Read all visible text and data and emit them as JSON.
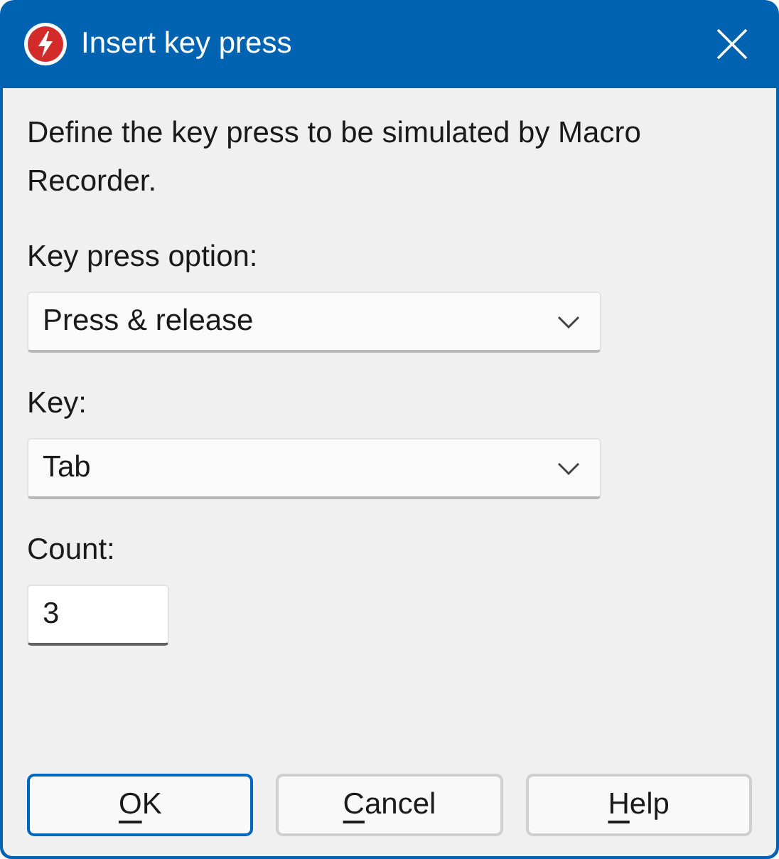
{
  "window": {
    "title": "Insert key press"
  },
  "description": "Define the key press to be simulated by Macro Recorder.",
  "fields": [
    {
      "kind": "dropdown",
      "label": "Key press option:",
      "value": "Press & release"
    },
    {
      "kind": "dropdown",
      "label": "Key:",
      "value": "Tab"
    },
    {
      "kind": "text",
      "label": "Count:",
      "value": "3"
    }
  ],
  "buttons": [
    {
      "mnemonic": "O",
      "rest": "K",
      "focused": true
    },
    {
      "mnemonic": "C",
      "rest": "ancel",
      "focused": false
    },
    {
      "mnemonic": "H",
      "rest": "elp",
      "focused": false
    }
  ]
}
